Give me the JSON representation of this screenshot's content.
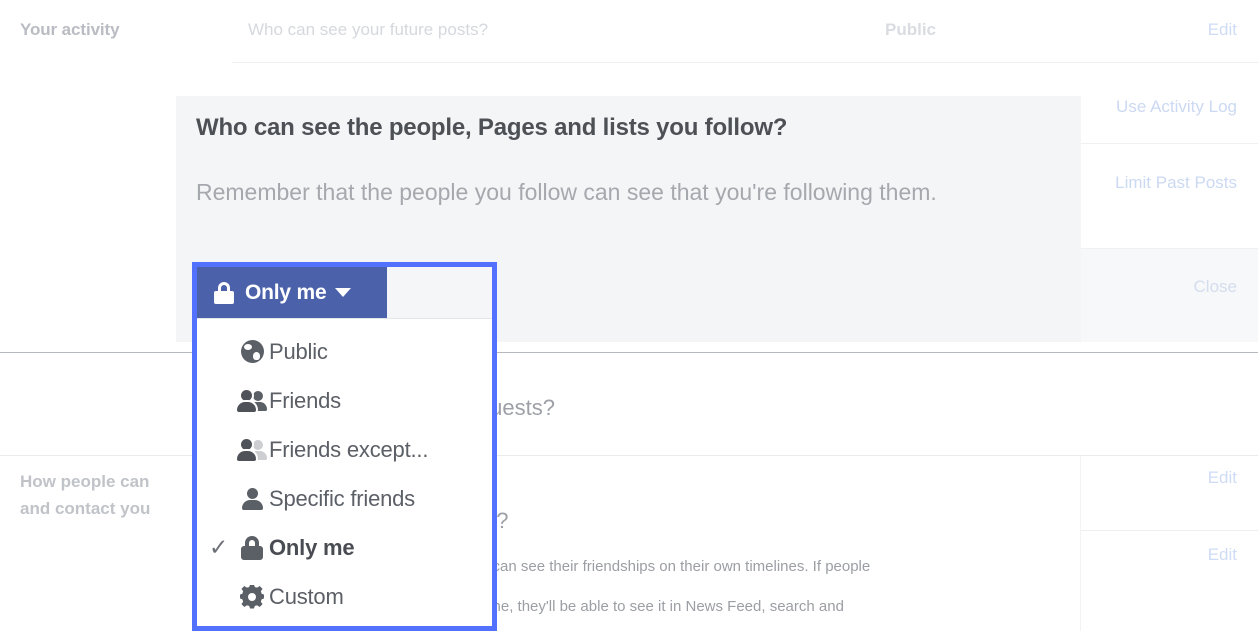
{
  "settings_page": {
    "top_row": {
      "section_label": "Your activity",
      "question": "Who can see your future posts?",
      "value": "Public",
      "edit_label": "Edit"
    },
    "side_links": {
      "activity_log": "Use Activity Log",
      "limit_past_posts": "Limit Past Posts",
      "close": "Close"
    },
    "obscured_background": {
      "question_requests": "d requests?",
      "question_friends_list": "ds list?",
      "body_line_1": "rol who can see their friendships on their own timelines. If people",
      "body_line_2": "er timeline, they'll be able to see it in News Feed, search and"
    },
    "lower_section": {
      "section_label_line_1": "How people can ",
      "section_label_line_2": "and contact you",
      "edit_label_1": "Edit",
      "edit_label_2": "Edit"
    }
  },
  "dialog": {
    "title": "Who can see the people, Pages and lists you follow?",
    "description": "Remember that the people you follow can see that you're following them."
  },
  "audience_selector": {
    "button": {
      "label": "Only me",
      "icon": "lock-icon",
      "caret": "chevron-down-icon",
      "background_color": "#4b62ab",
      "focus_border_color": "#5271ff"
    },
    "menu_items": [
      {
        "label": "Public",
        "icon": "globe-icon",
        "selected": false,
        "check": ""
      },
      {
        "label": "Friends",
        "icon": "friends-icon",
        "selected": false,
        "check": ""
      },
      {
        "label": "Friends except...",
        "icon": "friends-except-icon",
        "selected": false,
        "check": ""
      },
      {
        "label": "Specific friends",
        "icon": "person-icon",
        "selected": false,
        "check": ""
      },
      {
        "label": "Only me",
        "icon": "lock-icon",
        "selected": true,
        "check": "✓"
      },
      {
        "label": "Custom",
        "icon": "gear-icon",
        "selected": false,
        "check": ""
      }
    ]
  }
}
